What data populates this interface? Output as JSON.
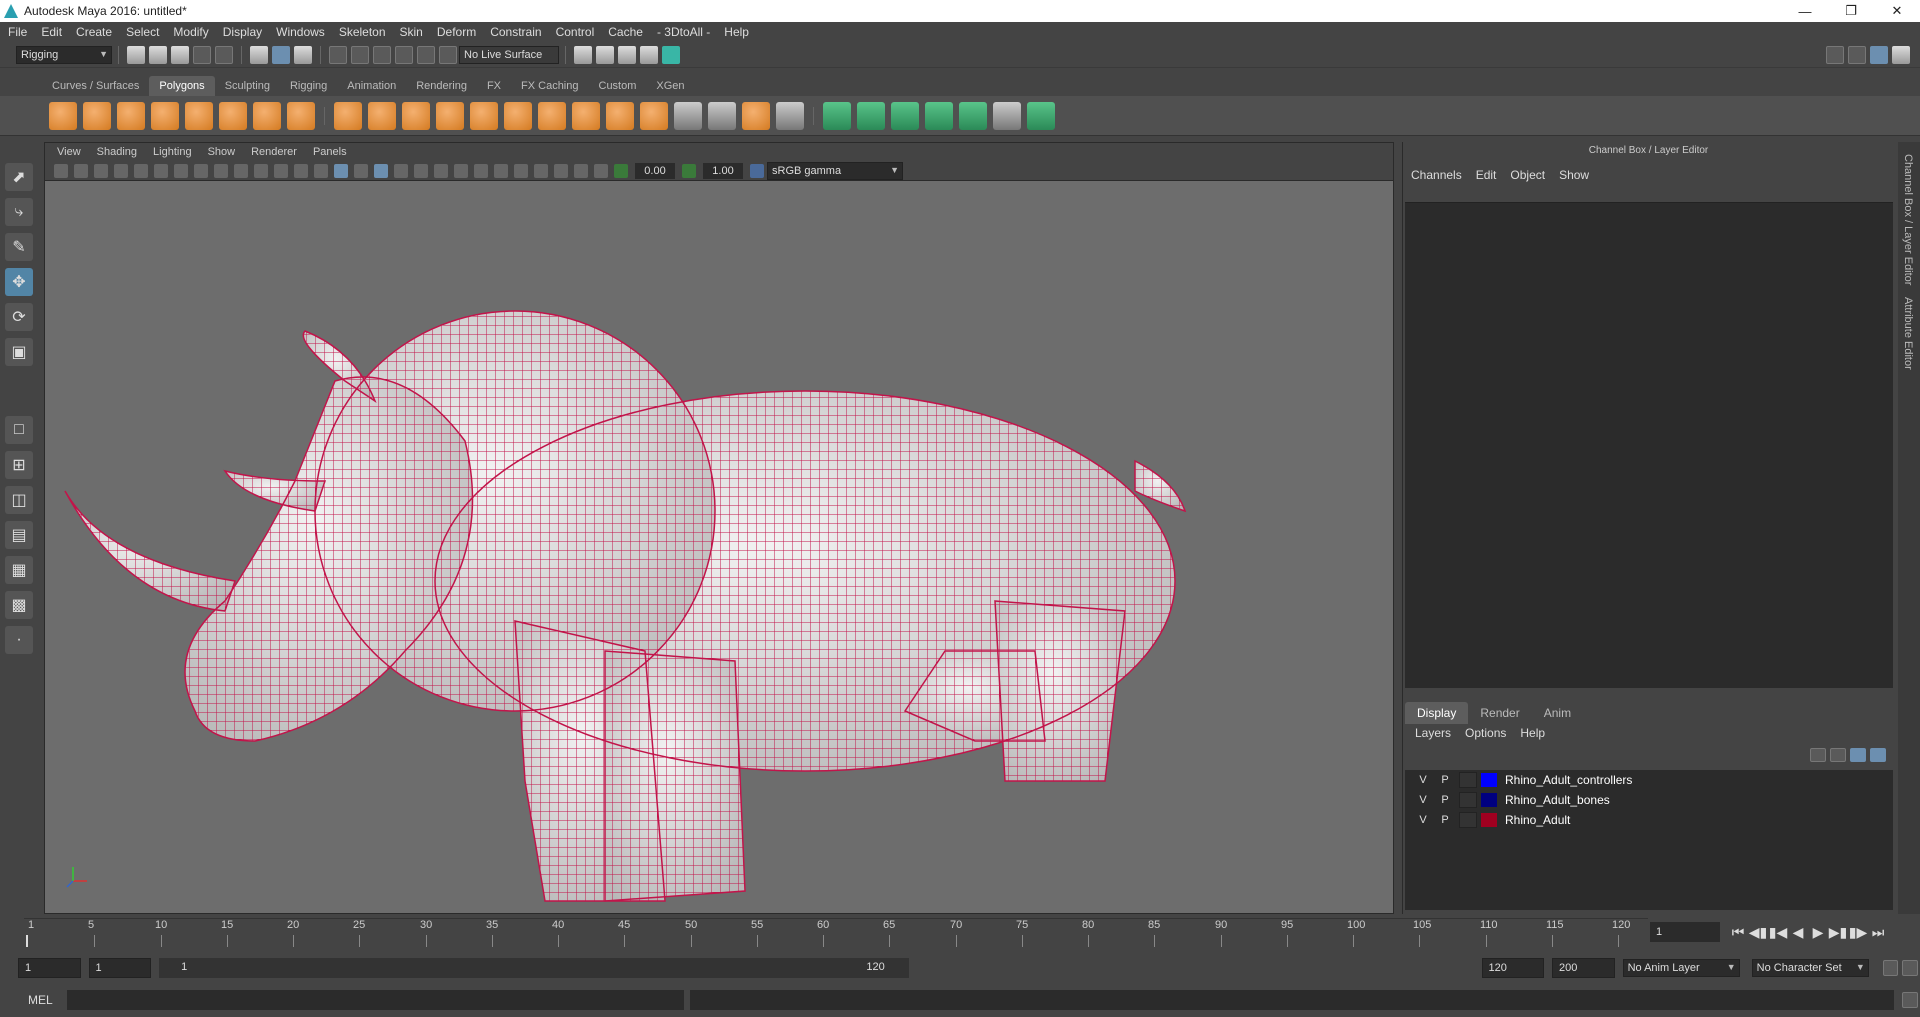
{
  "window": {
    "title": "Autodesk Maya 2016: untitled*"
  },
  "menubar": [
    "File",
    "Edit",
    "Create",
    "Select",
    "Modify",
    "Display",
    "Windows",
    "Skeleton",
    "Skin",
    "Deform",
    "Constrain",
    "Control",
    "Cache",
    "- 3DtoAll -",
    "Help"
  ],
  "statusline": {
    "menuset": "Rigging",
    "live_surface": "No Live Surface"
  },
  "shelf": {
    "tabs": [
      "Curves / Surfaces",
      "Polygons",
      "Sculpting",
      "Rigging",
      "Animation",
      "Rendering",
      "FX",
      "FX Caching",
      "Custom",
      "XGen"
    ],
    "active_tab": "Polygons"
  },
  "viewport": {
    "menu": [
      "View",
      "Shading",
      "Lighting",
      "Show",
      "Renderer",
      "Panels"
    ],
    "exposure": "0.00",
    "gamma": "1.00",
    "color_space": "sRGB gamma",
    "mesh_color": "#c2144a"
  },
  "right_panel": {
    "header": "Channel Box / Layer Editor",
    "menu": [
      "Channels",
      "Edit",
      "Object",
      "Show"
    ],
    "tabs": [
      "Display",
      "Render",
      "Anim"
    ],
    "active_tab": "Display",
    "sub_menu": [
      "Layers",
      "Options",
      "Help"
    ],
    "layers": [
      {
        "v": "V",
        "p": "P",
        "color": "#0000ff",
        "name": "Rhino_Adult_controllers"
      },
      {
        "v": "V",
        "p": "P",
        "color": "#000080",
        "name": "Rhino_Adult_bones"
      },
      {
        "v": "V",
        "p": "P",
        "color": "#a00020",
        "name": "Rhino_Adult"
      }
    ],
    "side_tabs": [
      "Channel Box / Layer Editor",
      "Attribute Editor"
    ]
  },
  "timeline": {
    "ticks": [
      "5",
      "10",
      "15",
      "20",
      "25",
      "30",
      "35",
      "40",
      "45",
      "50",
      "55",
      "60",
      "65",
      "70",
      "75",
      "80",
      "85",
      "90",
      "95",
      "100",
      "105",
      "110",
      "115",
      "120"
    ],
    "start_mark": "1",
    "current_frame": "1"
  },
  "range": {
    "start": "1",
    "playback_start": "1",
    "slider_start": "1",
    "slider_end": "120",
    "playback_end": "120",
    "end": "200",
    "anim_layer": "No Anim Layer",
    "character_set": "No Character Set"
  },
  "cmdline": {
    "label": "MEL"
  }
}
